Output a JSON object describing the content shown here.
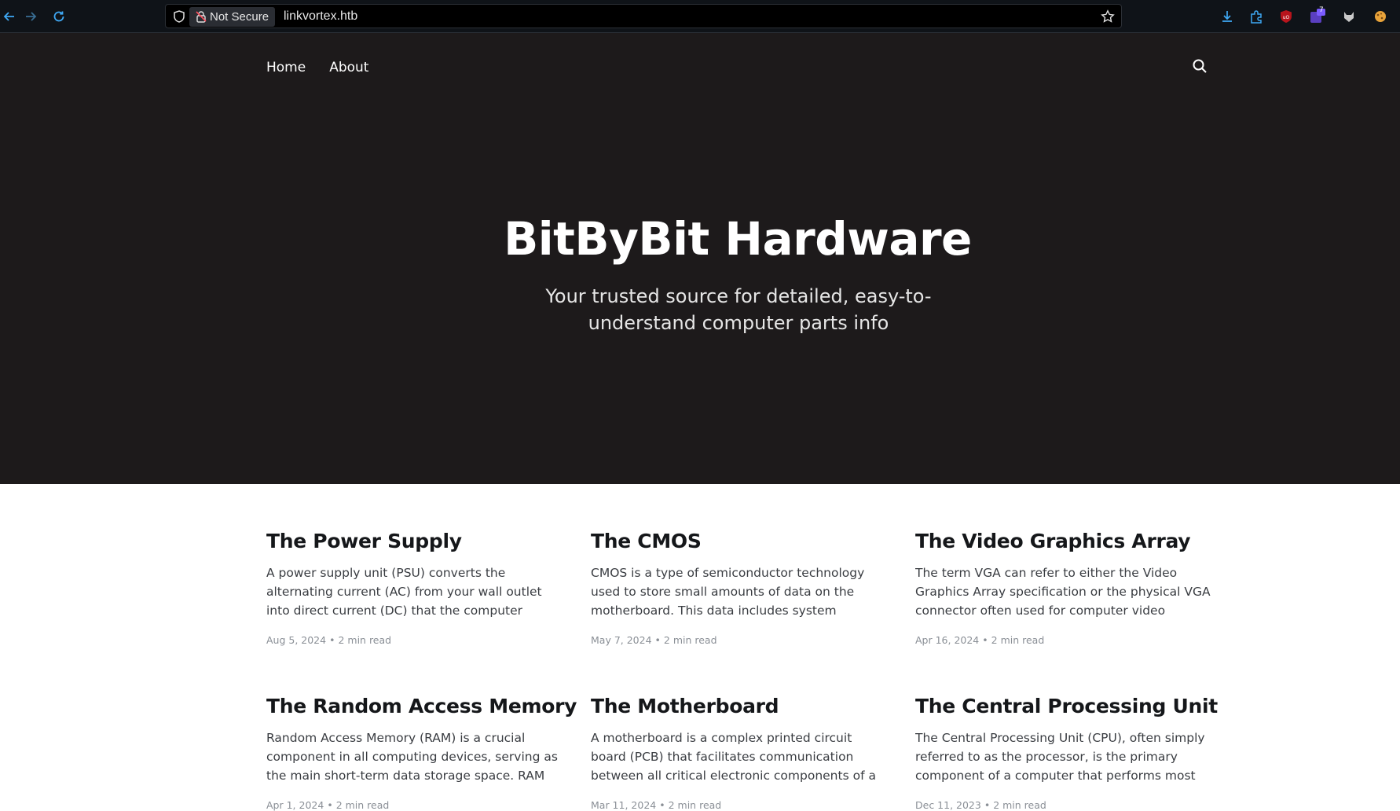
{
  "browser": {
    "security_label": "Not Secure",
    "url": "linkvortex.htb",
    "extension_badge": "7"
  },
  "site": {
    "nav": [
      "Home",
      "About"
    ],
    "title": "BitByBit Hardware",
    "subtitle": "Your trusted source for detailed, easy-to-understand computer parts info"
  },
  "posts": [
    {
      "title": "The Power Supply",
      "excerpt": "A power supply unit (PSU) converts the alternating current (AC) from your wall outlet into direct current (DC) that the computer components…",
      "date": "Aug 5, 2024",
      "read": "2 min read"
    },
    {
      "title": "The CMOS",
      "excerpt": "CMOS is a type of semiconductor technology used to store small amounts of data on the motherboard. This data includes system settings and…",
      "date": "May 7, 2024",
      "read": "2 min read"
    },
    {
      "title": "The Video Graphics Array",
      "excerpt": "The term VGA can refer to either the Video Graphics Array specification or the physical VGA connector often used for computer video output. Below, I'll…",
      "date": "Apr 16, 2024",
      "read": "2 min read"
    },
    {
      "title": "The Random Access Memory",
      "excerpt": "Random Access Memory (RAM) is a crucial component in all computing devices, serving as the main short-term data storage space. RAM stores t…",
      "date": "Apr 1, 2024",
      "read": "2 min read"
    },
    {
      "title": "The Motherboard",
      "excerpt": "A motherboard is a complex printed circuit board (PCB) that facilitates communication between all critical electronic components of a computer,…",
      "date": "Mar 11, 2024",
      "read": "2 min read"
    },
    {
      "title": "The Central Processing Unit",
      "excerpt": "The Central Processing Unit (CPU), often simply referred to as the processor, is the primary component of a computer that performs most of…",
      "date": "Dec 11, 2023",
      "read": "2 min read"
    }
  ],
  "colors": {
    "hero_bg": "#1d1a1b",
    "toolbar_bg": "#0f1318",
    "accent_blue": "#3fa9f5"
  }
}
